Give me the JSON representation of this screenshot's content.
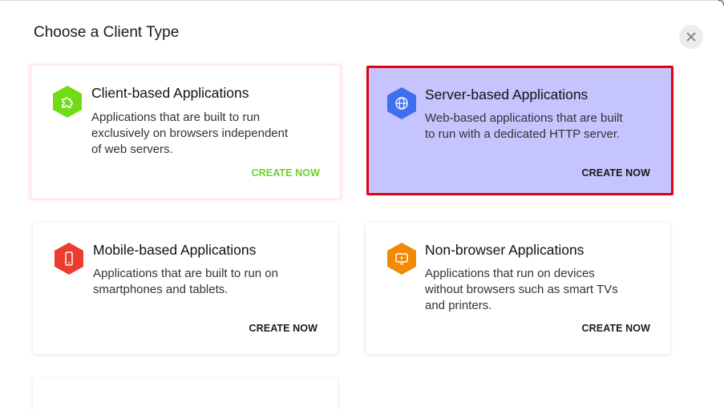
{
  "dialog": {
    "title": "Choose a Client Type",
    "close_icon": "close-icon"
  },
  "cards": [
    {
      "title": "Client-based Applications",
      "description": "Applications that are built to run exclusively on browsers independent of web servers.",
      "cta": "CREATE NOW",
      "icon": "puzzle-icon",
      "icon_color": "#6fdc16",
      "cta_color": "#6fd12a"
    },
    {
      "title": "Server-based Applications",
      "description": "Web-based applications that are built to run with a dedicated HTTP server.",
      "cta": "CREATE NOW",
      "icon": "globe-icon",
      "icon_color": "#3f6ef0",
      "selected": true
    },
    {
      "title": "Mobile-based Applications",
      "description": "Applications that are built to run on smartphones and tablets.",
      "cta": "CREATE NOW",
      "icon": "smartphone-icon",
      "icon_color": "#ee3b2f"
    },
    {
      "title": "Non-browser Applications",
      "description": "Applications that run on devices without browsers such as smart TVs and printers.",
      "cta": "CREATE NOW",
      "icon": "tv-icon",
      "icon_color": "#f28a06"
    }
  ]
}
